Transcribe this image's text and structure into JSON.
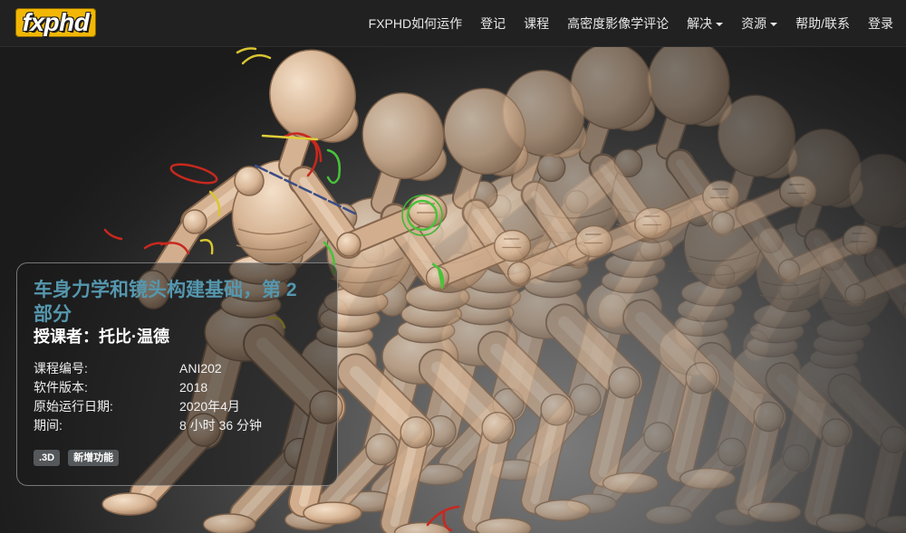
{
  "logo": {
    "text": "fxphd"
  },
  "nav": {
    "items": [
      {
        "label": "FXPHD如何运作"
      },
      {
        "label": "登记"
      },
      {
        "label": "课程"
      },
      {
        "label": "高密度影像学评论"
      },
      {
        "label": "解决",
        "icon": "caret-down-icon"
      },
      {
        "label": "资源",
        "icon": "caret-down-icon"
      },
      {
        "label": "帮助/联系"
      },
      {
        "label": "登录"
      }
    ]
  },
  "course": {
    "title": "车身力学和镜头构建基础，第 2 部分",
    "instructor": "授课者：托比·温德",
    "details": [
      {
        "label": "课程编号:",
        "value": "ANI202"
      },
      {
        "label": "软件版本:",
        "value": "2018"
      },
      {
        "label": "原始运行日期:",
        "value": "2020年4月"
      },
      {
        "label": "期间:",
        "value": "8 小时 36 分钟"
      }
    ],
    "tags": [
      ".3D",
      "新增功能"
    ]
  },
  "colors": {
    "logo_bg": "#f2b705",
    "title": "#5597ae",
    "nav_bg": "#212121",
    "tag_bg": "#55585b"
  }
}
